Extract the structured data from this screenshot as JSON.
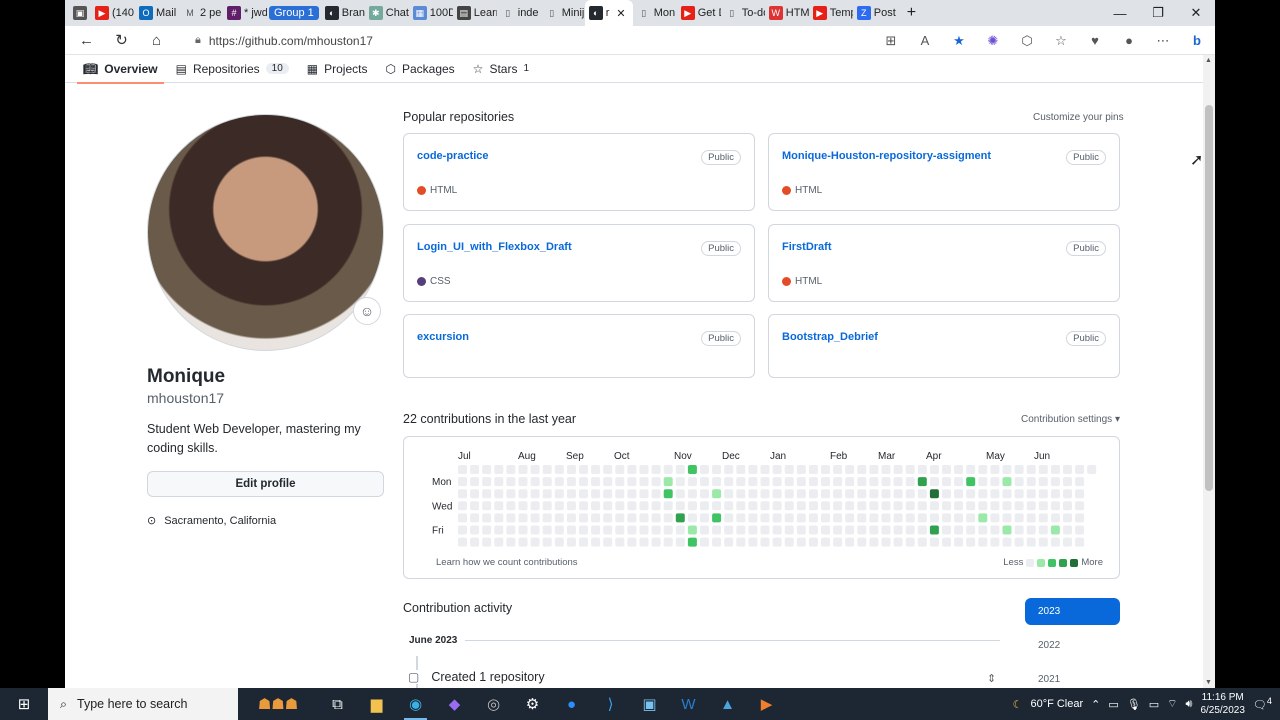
{
  "browser": {
    "tabs": [
      {
        "label": "(140",
        "icon": "youtube-icon"
      },
      {
        "label": "Mail",
        "icon": "outlook-icon"
      },
      {
        "label": "2 pe",
        "icon": "gmail-icon"
      },
      {
        "label": "* jwd",
        "icon": "slack-icon"
      },
      {
        "label": "Branc",
        "icon": "github-icon"
      },
      {
        "label": "Chat",
        "icon": "chatgpt-icon"
      },
      {
        "label": "100D",
        "icon": "page-icon"
      },
      {
        "label": "Learn",
        "icon": "learn-icon"
      },
      {
        "label": "inde",
        "icon": "doc-icon"
      },
      {
        "label": "Minij",
        "icon": "doc-icon"
      },
      {
        "label": "r",
        "icon": "github-icon"
      },
      {
        "label": "Mon",
        "icon": "doc-icon"
      },
      {
        "label": "Get D",
        "icon": "youtube-icon"
      },
      {
        "label": "To-do",
        "icon": "doc-icon"
      },
      {
        "label": "HTM",
        "icon": "w3-icon"
      },
      {
        "label": "Temp",
        "icon": "youtube-icon"
      },
      {
        "label": "Post",
        "icon": "z-icon"
      }
    ],
    "tab_group_label": "Group 1",
    "url": "https://github.com/mhouston17"
  },
  "profile_nav": {
    "tabs": [
      {
        "label": "Overview",
        "count": ""
      },
      {
        "label": "Repositories",
        "count": "10"
      },
      {
        "label": "Projects",
        "count": ""
      },
      {
        "label": "Packages",
        "count": ""
      },
      {
        "label": "Stars",
        "count": "1"
      }
    ]
  },
  "profile": {
    "name": "Monique",
    "login": "mhouston17",
    "bio": "Student Web Developer, mastering my coding skills.",
    "edit_label": "Edit profile",
    "location": "Sacramento, California"
  },
  "pinned": {
    "title": "Popular repositories",
    "customize": "Customize your pins",
    "repos": [
      {
        "name": "code-practice",
        "visibility": "Public",
        "language": "HTML",
        "lang_color": "#e34c26"
      },
      {
        "name": "Monique-Houston-repository-assigment",
        "visibility": "Public",
        "language": "HTML",
        "lang_color": "#e34c26"
      },
      {
        "name": "Login_UI_with_Flexbox_Draft",
        "visibility": "Public",
        "language": "CSS",
        "lang_color": "#563d7c"
      },
      {
        "name": "FirstDraft",
        "visibility": "Public",
        "language": "HTML",
        "lang_color": "#e34c26"
      },
      {
        "name": "excursion",
        "visibility": "Public",
        "language": "",
        "lang_color": ""
      },
      {
        "name": "Bootstrap_Debrief",
        "visibility": "Public",
        "language": "",
        "lang_color": ""
      }
    ]
  },
  "contributions": {
    "title": "22 contributions in the last year",
    "settings": "Contribution settings ▾",
    "months": [
      "Jul",
      "Aug",
      "Sep",
      "Oct",
      "Nov",
      "Dec",
      "Jan",
      "Feb",
      "Mar",
      "Apr",
      "May",
      "Jun"
    ],
    "days": [
      "Mon",
      "Wed",
      "Fri"
    ],
    "learn": "Learn how we count contributions",
    "less": "Less",
    "more": "More",
    "palette": [
      "#ebedf0",
      "#9be9a8",
      "#40c463",
      "#30a14e",
      "#216e39"
    ],
    "active_cells": [
      {
        "w": 17,
        "d": 1,
        "level": 1
      },
      {
        "w": 17,
        "d": 2,
        "level": 2
      },
      {
        "w": 18,
        "d": 4,
        "level": 3
      },
      {
        "w": 19,
        "d": 0,
        "level": 2
      },
      {
        "w": 19,
        "d": 5,
        "level": 1
      },
      {
        "w": 19,
        "d": 6,
        "level": 2
      },
      {
        "w": 21,
        "d": 2,
        "level": 1
      },
      {
        "w": 21,
        "d": 4,
        "level": 2
      },
      {
        "w": 38,
        "d": 1,
        "level": 3
      },
      {
        "w": 39,
        "d": 2,
        "level": 4
      },
      {
        "w": 39,
        "d": 5,
        "level": 3
      },
      {
        "w": 42,
        "d": 1,
        "level": 2
      },
      {
        "w": 43,
        "d": 4,
        "level": 1
      },
      {
        "w": 45,
        "d": 1,
        "level": 1
      },
      {
        "w": 45,
        "d": 5,
        "level": 1
      },
      {
        "w": 49,
        "d": 5,
        "level": 1
      }
    ]
  },
  "activity": {
    "title": "Contribution activity",
    "month": "June 2023",
    "item": "Created 1 repository",
    "years": [
      "2023",
      "2022",
      "2021"
    ]
  },
  "taskbar": {
    "search_placeholder": "Type here to search",
    "weather": "60°F  Clear",
    "time": "11:16 PM",
    "date": "6/25/2023",
    "notifications": "4"
  }
}
